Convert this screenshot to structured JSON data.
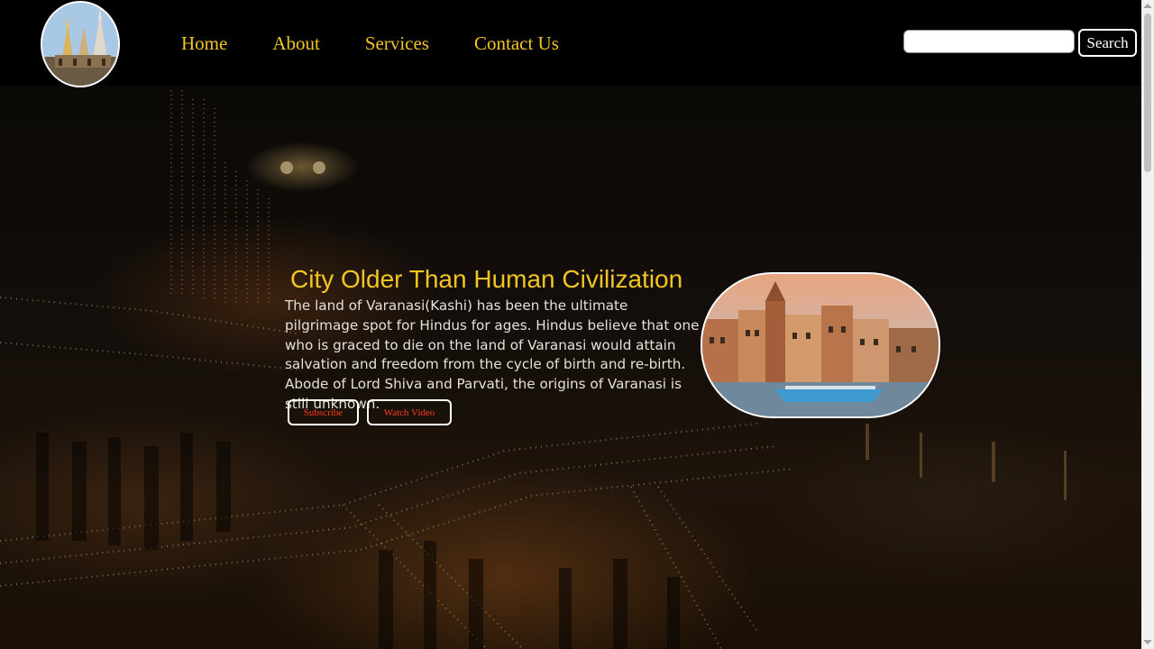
{
  "nav": {
    "logo_icon": "kashi-temple-logo",
    "links": [
      {
        "label": "Home"
      },
      {
        "label": "About"
      },
      {
        "label": "Services"
      },
      {
        "label": "Contact Us"
      }
    ],
    "search": {
      "placeholder": "",
      "value": "",
      "button_label": "Search"
    }
  },
  "hero": {
    "title": "City Older Than Human Civilization",
    "description": "The land of Varanasi(Kashi) has been the ultimate pilgrimage spot for Hindus for ages. Hindus believe that one who is graced to die on the land of Varanasi would attain salvation and freedom from the cycle of birth and re-birth. Abode of Lord Shiva and Parvati, the origins of Varanasi is still unknown.",
    "buttons": {
      "subscribe": "Subscribe",
      "watch": "Watch Video"
    },
    "image_icon": "varanasi-ghats-boat-image",
    "background_icon": "varanasi-ghat-night-lamps-photo"
  },
  "colors": {
    "accent": "#f2c522",
    "button_text": "#ff3a1a",
    "navbar_bg": "#000000",
    "body_text": "#e4e0da"
  }
}
